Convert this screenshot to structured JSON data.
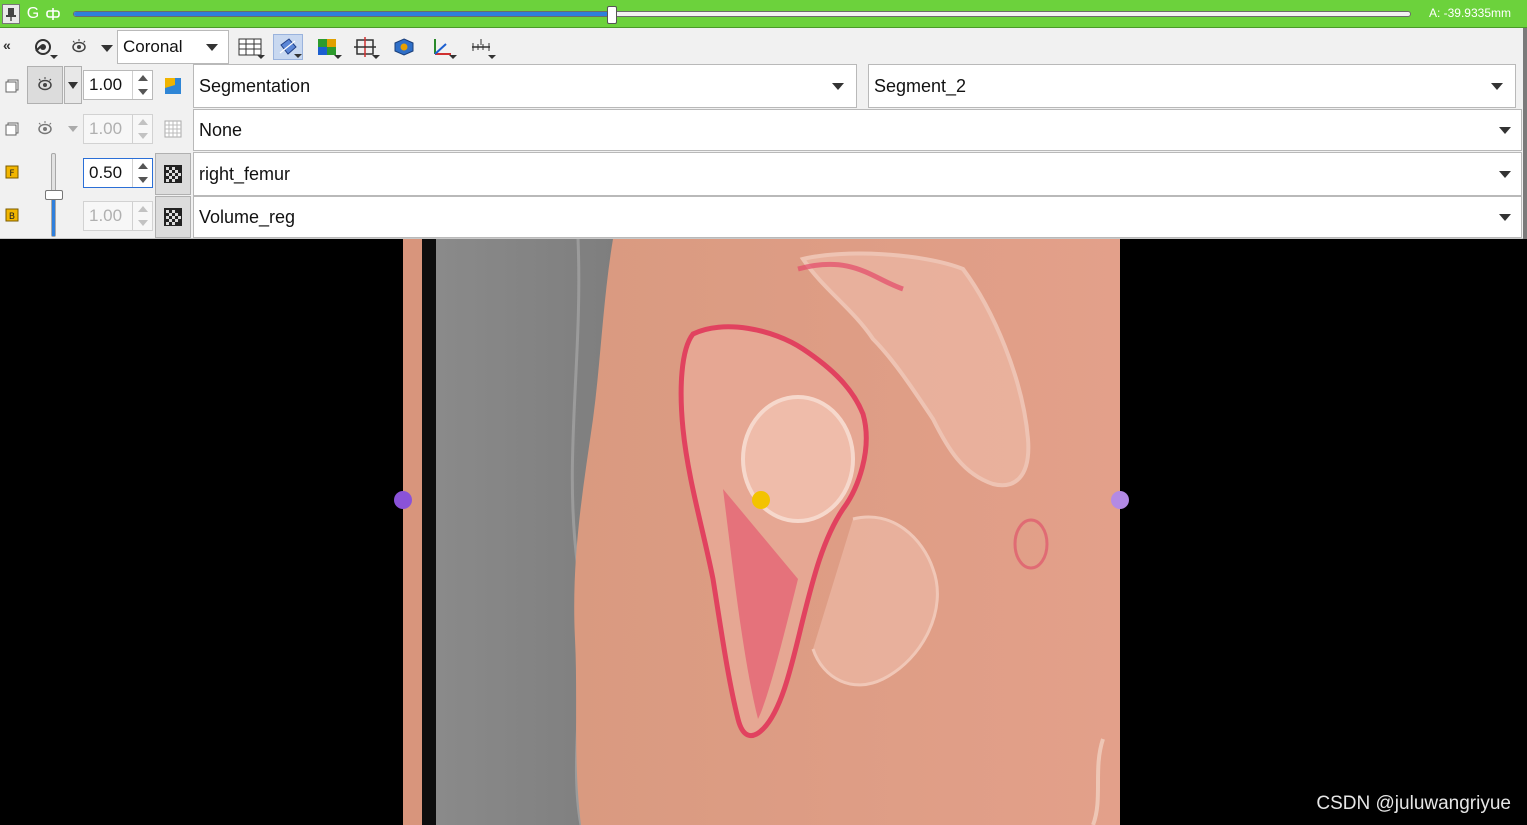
{
  "slice_bar": {
    "g_label": "G",
    "offset_readout": "A: -39.9335mm",
    "slider_position": 0.403,
    "color": "#6cd23c"
  },
  "toolbar": {
    "collapse_label": "«",
    "orientation": "Coronal",
    "icons": [
      "link-icon",
      "eye-icon",
      "layout-grid-icon",
      "reformat-icon",
      "lightbox-icon",
      "crosshair-icon",
      "volume-render-icon",
      "axes-icon",
      "ruler-icon"
    ]
  },
  "layers": {
    "segmentation": {
      "opacity": "1.00",
      "node": "Segmentation",
      "segment": "Segment_2"
    },
    "label": {
      "opacity": "1.00",
      "node": "None"
    },
    "foreground": {
      "opacity": "0.50",
      "node": "right_femur"
    },
    "background": {
      "opacity": "1.00",
      "node": "Volume_reg"
    },
    "fg_bg_blend": 0.5
  },
  "view": {
    "left_marker_color": "#8a52d8",
    "center_marker_color": "#f3c300",
    "right_marker_color": "#b38ae4",
    "watermark": "CSDN @juluwangriyue"
  }
}
